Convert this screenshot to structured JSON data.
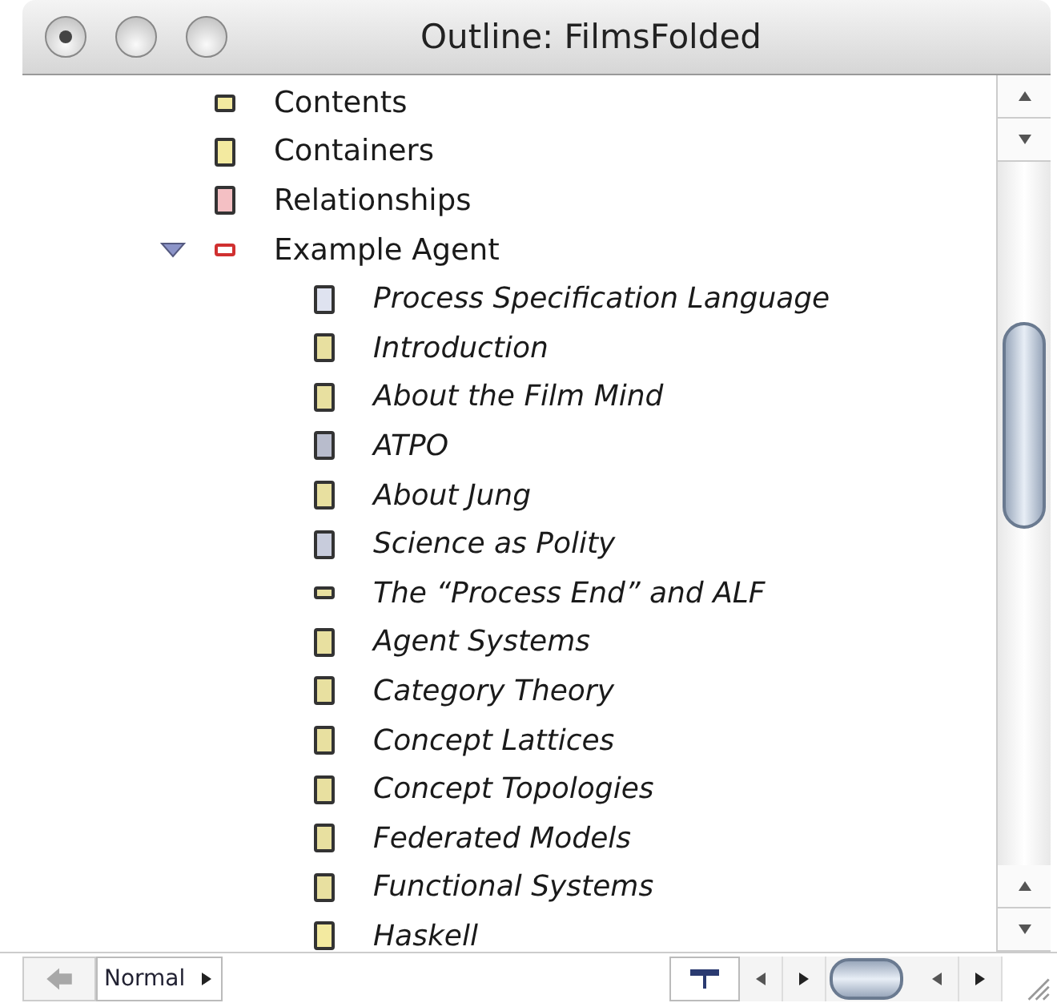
{
  "window": {
    "title": "Outline: FilmsFolded"
  },
  "outline": [
    {
      "label": "Contents",
      "kind": "short",
      "color": "#f3eaa0"
    },
    {
      "label": "Containers",
      "kind": "page",
      "color": "#f3eaa0"
    },
    {
      "label": "Relationships",
      "kind": "page",
      "color": "#f4c0c4"
    },
    {
      "label": "Example Agent",
      "kind": "outline",
      "color": "#d03030",
      "expanded": true,
      "children": [
        {
          "label": "Process Specification Language",
          "kind": "page",
          "color": "#dfe3f0"
        },
        {
          "label": "Introduction",
          "kind": "page",
          "color": "#e8e0a0"
        },
        {
          "label": "About the Film Mind",
          "kind": "page",
          "color": "#e8e0a0"
        },
        {
          "label": "ATPO",
          "kind": "page",
          "color": "#b8bccc"
        },
        {
          "label": "About Jung",
          "kind": "page",
          "color": "#e8e0a0"
        },
        {
          "label": "Science as Polity",
          "kind": "page",
          "color": "#c8ccdc"
        },
        {
          "label": "The “Process End” and ALF",
          "kind": "flat",
          "color": "#e8e0a0"
        },
        {
          "label": "Agent Systems",
          "kind": "page",
          "color": "#e8e0a0"
        },
        {
          "label": "Category Theory",
          "kind": "page",
          "color": "#e8e0a0"
        },
        {
          "label": "Concept Lattices",
          "kind": "page",
          "color": "#e8e0a0"
        },
        {
          "label": "Concept Topologies",
          "kind": "page",
          "color": "#e8e0a0"
        },
        {
          "label": "Federated Models",
          "kind": "page",
          "color": "#e8e0a0"
        },
        {
          "label": "Functional Systems",
          "kind": "page",
          "color": "#e8e0a0"
        },
        {
          "label": "Haskell",
          "kind": "page",
          "color": "#f3eaa0"
        }
      ]
    }
  ],
  "footer": {
    "mode": "Normal"
  }
}
